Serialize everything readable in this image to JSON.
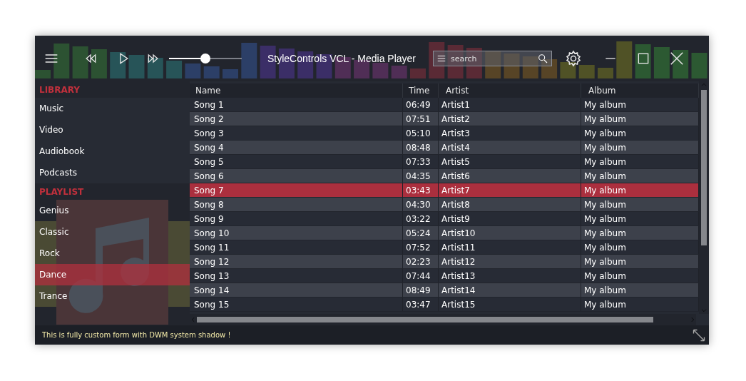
{
  "window": {
    "title": "StyleControls VCL - Media Player"
  },
  "volume": {
    "level": 0.5
  },
  "search": {
    "placeholder": "search"
  },
  "sidebar": {
    "sections": [
      {
        "title": "LIBRARY",
        "items": [
          {
            "label": "Music",
            "selected": false
          },
          {
            "label": "Video",
            "selected": false
          },
          {
            "label": "Audiobook",
            "selected": false
          },
          {
            "label": "Podcasts",
            "selected": false
          }
        ]
      },
      {
        "title": "PLAYLIST",
        "items": [
          {
            "label": "Genius",
            "selected": false
          },
          {
            "label": "Classic",
            "selected": false
          },
          {
            "label": "Rock",
            "selected": false
          },
          {
            "label": "Dance",
            "selected": true
          },
          {
            "label": "Trance",
            "selected": false
          }
        ]
      }
    ]
  },
  "table": {
    "columns": [
      "Name",
      "Time",
      "Artist",
      "Album"
    ],
    "rows": [
      {
        "cells": [
          "Song 1",
          "06:49",
          "Artist1",
          "My album"
        ],
        "selected": false
      },
      {
        "cells": [
          "Song 2",
          "07:51",
          "Artist2",
          "My album"
        ],
        "selected": false
      },
      {
        "cells": [
          "Song 3",
          "05:10",
          "Artist3",
          "My album"
        ],
        "selected": false
      },
      {
        "cells": [
          "Song 4",
          "08:48",
          "Artist4",
          "My album"
        ],
        "selected": false
      },
      {
        "cells": [
          "Song 5",
          "07:33",
          "Artist5",
          "My album"
        ],
        "selected": false
      },
      {
        "cells": [
          "Song 6",
          "04:35",
          "Artist6",
          "My album"
        ],
        "selected": false
      },
      {
        "cells": [
          "Song 7",
          "03:43",
          "Artist7",
          "My album"
        ],
        "selected": true
      },
      {
        "cells": [
          "Song 8",
          "04:30",
          "Artist8",
          "My album"
        ],
        "selected": false
      },
      {
        "cells": [
          "Song 9",
          "03:22",
          "Artist9",
          "My album"
        ],
        "selected": false
      },
      {
        "cells": [
          "Song 10",
          "05:24",
          "Artist10",
          "My album"
        ],
        "selected": false
      },
      {
        "cells": [
          "Song 11",
          "07:52",
          "Artist11",
          "My album"
        ],
        "selected": false
      },
      {
        "cells": [
          "Song 12",
          "02:23",
          "Artist12",
          "My album"
        ],
        "selected": false
      },
      {
        "cells": [
          "Song 13",
          "07:44",
          "Artist13",
          "My album"
        ],
        "selected": false
      },
      {
        "cells": [
          "Song 14",
          "08:49",
          "Artist14",
          "My album"
        ],
        "selected": false
      },
      {
        "cells": [
          "Song 15",
          "03:47",
          "Artist15",
          "My album"
        ],
        "selected": false
      }
    ]
  },
  "status_bar": {
    "text": "This is fully custom form with DWM system shadow !"
  }
}
